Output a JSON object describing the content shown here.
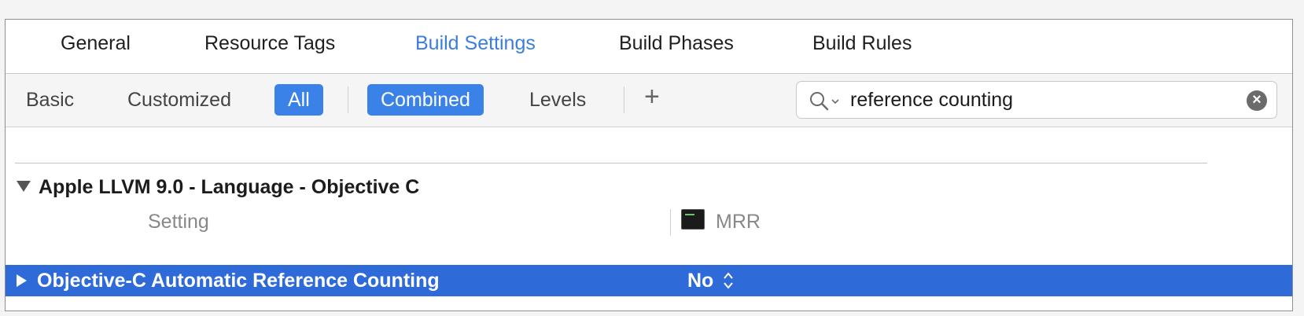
{
  "tabs": [
    "General",
    "Resource Tags",
    "Build Settings",
    "Build Phases",
    "Build Rules"
  ],
  "active_tab": "Build Settings",
  "filter": {
    "basic": "Basic",
    "customized": "Customized",
    "all": "All",
    "combined": "Combined",
    "levels": "Levels",
    "add": "+"
  },
  "search": {
    "value": "reference counting",
    "clear": "×"
  },
  "section": {
    "title": "Apple LLVM 9.0 - Language - Objective C"
  },
  "columns": {
    "setting": "Setting",
    "target": "MRR"
  },
  "setting_row": {
    "label": "Objective-C Automatic Reference Counting",
    "value": "No"
  },
  "colors": {
    "accent": "#3b82e8",
    "selection": "#2f6ad9",
    "active_tab": "#3b7ee0"
  }
}
